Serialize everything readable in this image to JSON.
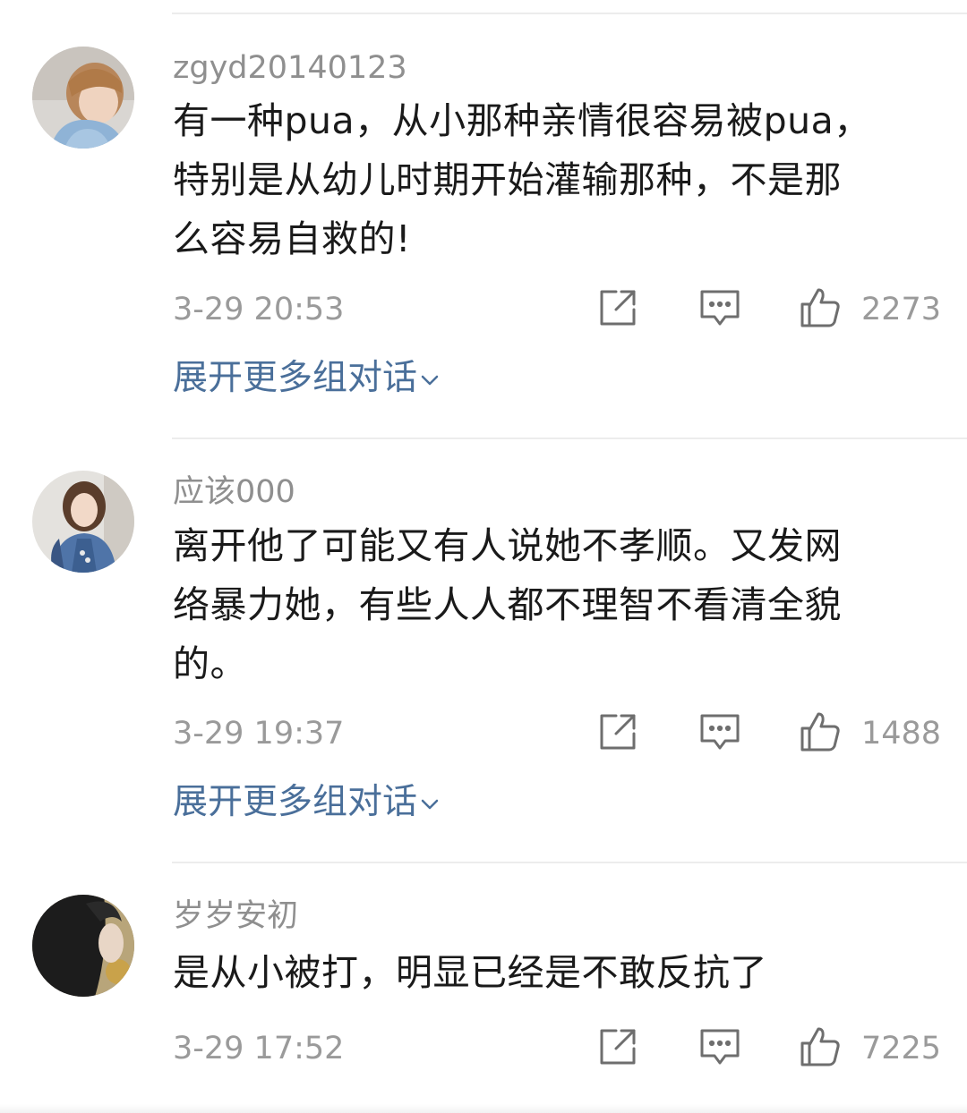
{
  "comments": [
    {
      "username": "zgyd20140123",
      "text": "有一种pua，从小那种亲情很容易被pua，特别是从幼儿时期开始灌输那种，不是那么容易自救的!",
      "lines": [
        "有一种pua，从小那种亲情很容易被pua，",
        "特别是从幼儿时期开始灌输那种，不是那",
        "么容易自救的!"
      ],
      "time": "3-29 20:53",
      "likes": "2273",
      "expand_label": "展开更多组对话"
    },
    {
      "username": "应该000",
      "text": "离开他了可能又有人说她不孝顺。又发网络暴力她，有些人人都不理智不看清全貌的。",
      "lines": [
        "离开他了可能又有人说她不孝顺。又发网",
        "络暴力她，有些人人都不理智不看清全貌",
        "的。"
      ],
      "time": "3-29 19:37",
      "likes": "1488",
      "expand_label": "展开更多组对话"
    },
    {
      "username": "岁岁安初",
      "text": "是从小被打，明显已经是不敢反抗了",
      "lines": [
        "是从小被打，明显已经是不敢反抗了"
      ],
      "time": "3-29 17:52",
      "likes": "7225"
    }
  ],
  "icons": {
    "share": "share-icon",
    "reply": "comment-icon",
    "like": "thumbs-up-icon",
    "expand": "chevron-down-icon"
  },
  "colors": {
    "link": "#4a6f9a",
    "meta": "#9a9a9a",
    "text": "#1a1a1a",
    "username": "#8f8f8f"
  }
}
